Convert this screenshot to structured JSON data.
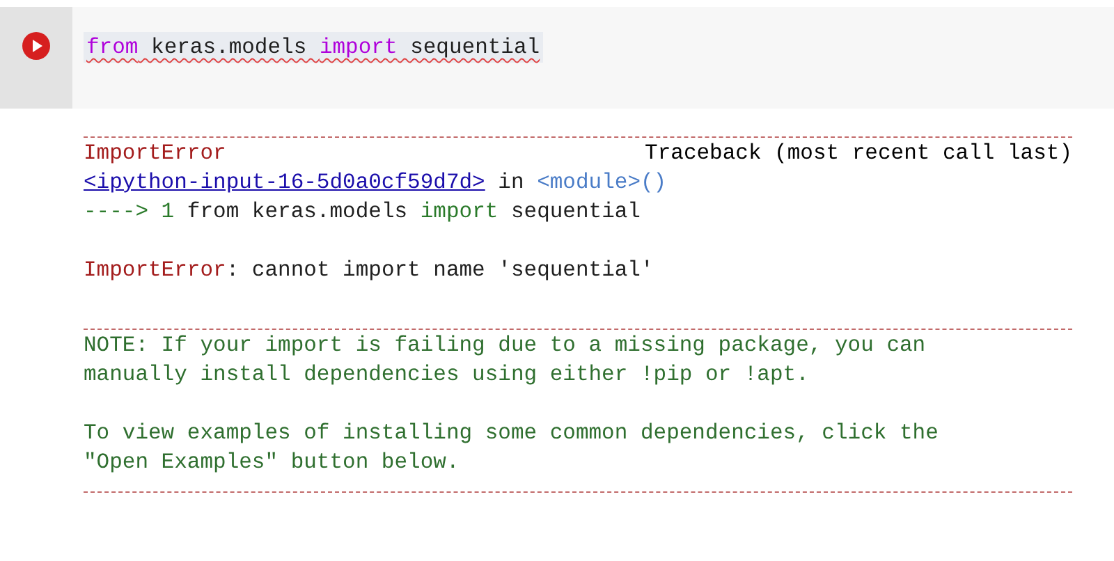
{
  "cell": {
    "error_underline": true,
    "code": [
      {
        "text": "from",
        "kind": "keyword"
      },
      {
        "text": " keras.models ",
        "kind": "plain"
      },
      {
        "text": "import",
        "kind": "keyword"
      },
      {
        "text": " sequential",
        "kind": "plain"
      }
    ]
  },
  "output": {
    "header": {
      "error_type": "ImportError",
      "label": "Traceback (most recent call last)"
    },
    "location": [
      {
        "text": "<ipython-input-16-5d0a0cf59d7d>",
        "kind": "link"
      },
      {
        "text": " in ",
        "kind": "plain"
      },
      {
        "text": "<module>()",
        "kind": "module"
      }
    ],
    "source_line": [
      {
        "text": "----> 1 ",
        "kind": "arrow"
      },
      {
        "text": "from keras.models ",
        "kind": "plain"
      },
      {
        "text": "import",
        "kind": "keyword"
      },
      {
        "text": " sequential",
        "kind": "plain"
      }
    ],
    "error_message": [
      {
        "text": "ImportError",
        "kind": "error"
      },
      {
        "text": ": cannot import name 'sequential'",
        "kind": "plain"
      }
    ],
    "note": [
      "NOTE: If your import is failing due to a missing package, you can",
      "manually install dependencies using either !pip or !apt."
    ],
    "hint": [
      "To view examples of installing some common dependencies, click the",
      "\"Open Examples\" button below."
    ]
  }
}
